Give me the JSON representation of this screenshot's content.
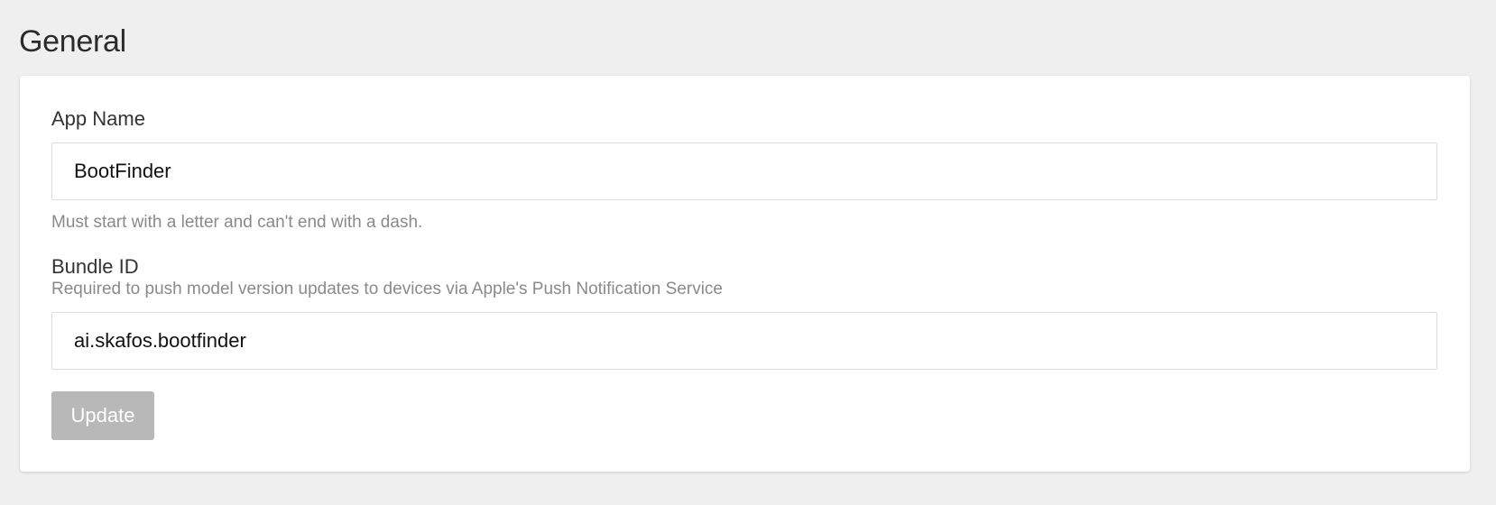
{
  "page": {
    "section_title": "General"
  },
  "form": {
    "app_name": {
      "label": "App Name",
      "value": "BootFinder",
      "help": "Must start with a letter and can't end with a dash."
    },
    "bundle_id": {
      "label": "Bundle ID",
      "help": "Required to push model version updates to devices via Apple's Push Notification Service",
      "value": "ai.skafos.bootfinder"
    },
    "submit": {
      "label": "Update",
      "disabled": true
    }
  },
  "colors": {
    "background": "#efefef",
    "card": "#ffffff",
    "button_disabled": "#b8b8b8",
    "help_text": "#8a8a8a"
  }
}
